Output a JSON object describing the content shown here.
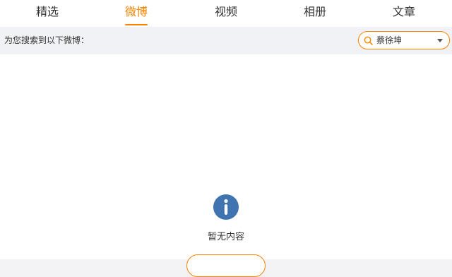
{
  "tabs": [
    {
      "label": "精选"
    },
    {
      "label": "微博"
    },
    {
      "label": "视频"
    },
    {
      "label": "相册"
    },
    {
      "label": "文章"
    }
  ],
  "active_tab": "微博",
  "search_bar": {
    "label": "为您搜索到以下微博：",
    "keyword": "蔡徐坤",
    "icon": "search-icon",
    "dropdown_icon": "chevron-down-icon"
  },
  "empty_state": {
    "icon": "info-icon",
    "text": "暂无内容"
  },
  "colors": {
    "accent": "#ff8200",
    "info_icon": "#3f74b0",
    "text": "#333333",
    "bar_background": "#f1f2f5"
  }
}
